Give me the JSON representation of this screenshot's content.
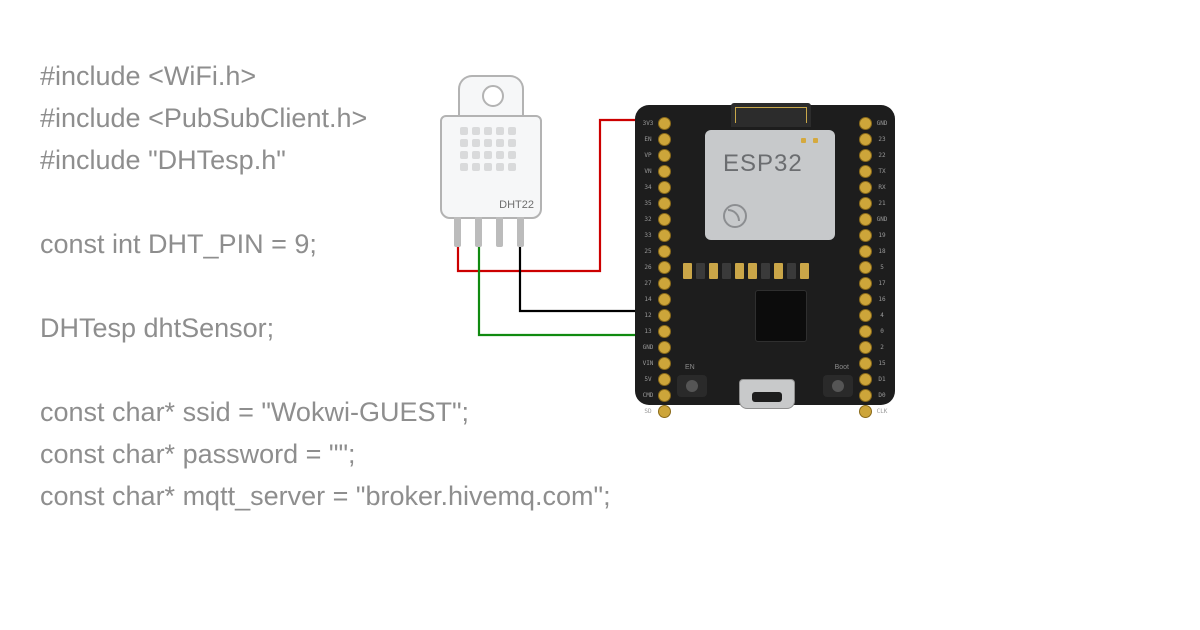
{
  "code_lines": [
    "#include <WiFi.h>",
    "#include <PubSubClient.h>",
    "#include \"DHTesp.h\"",
    "",
    "const int DHT_PIN = 9;",
    "",
    "DHTesp dhtSensor;",
    "",
    "const char* ssid = \"Wokwi-GUEST\";",
    "const char* password = \"\";",
    "const char* mqtt_server = \"broker.hivemq.com\";"
  ],
  "dht_label": "DHT22",
  "chip_label": "ESP32",
  "btn_en": "EN",
  "btn_boot": "Boot",
  "pins_left": [
    "3V3",
    "EN",
    "VP",
    "VN",
    "34",
    "35",
    "32",
    "33",
    "25",
    "26",
    "27",
    "14",
    "12",
    "13",
    "GND",
    "VIN",
    "5V",
    "CMD",
    "SD"
  ],
  "pins_right": [
    "GND",
    "23",
    "22",
    "TX",
    "RX",
    "21",
    "GND",
    "19",
    "18",
    "5",
    "17",
    "16",
    "4",
    "0",
    "2",
    "15",
    "D1",
    "D0",
    "CLK"
  ],
  "wires": {
    "vcc": {
      "color": "#cc0000",
      "from": "DHT22 pin1 VCC",
      "to": "ESP32 3V3"
    },
    "data": {
      "color": "#108a10",
      "from": "DHT22 pin2 SDA",
      "to": "ESP32 GPIO"
    },
    "gnd": {
      "color": "#000000",
      "from": "DHT22 pin4 GND",
      "to": "ESP32 GND"
    }
  }
}
